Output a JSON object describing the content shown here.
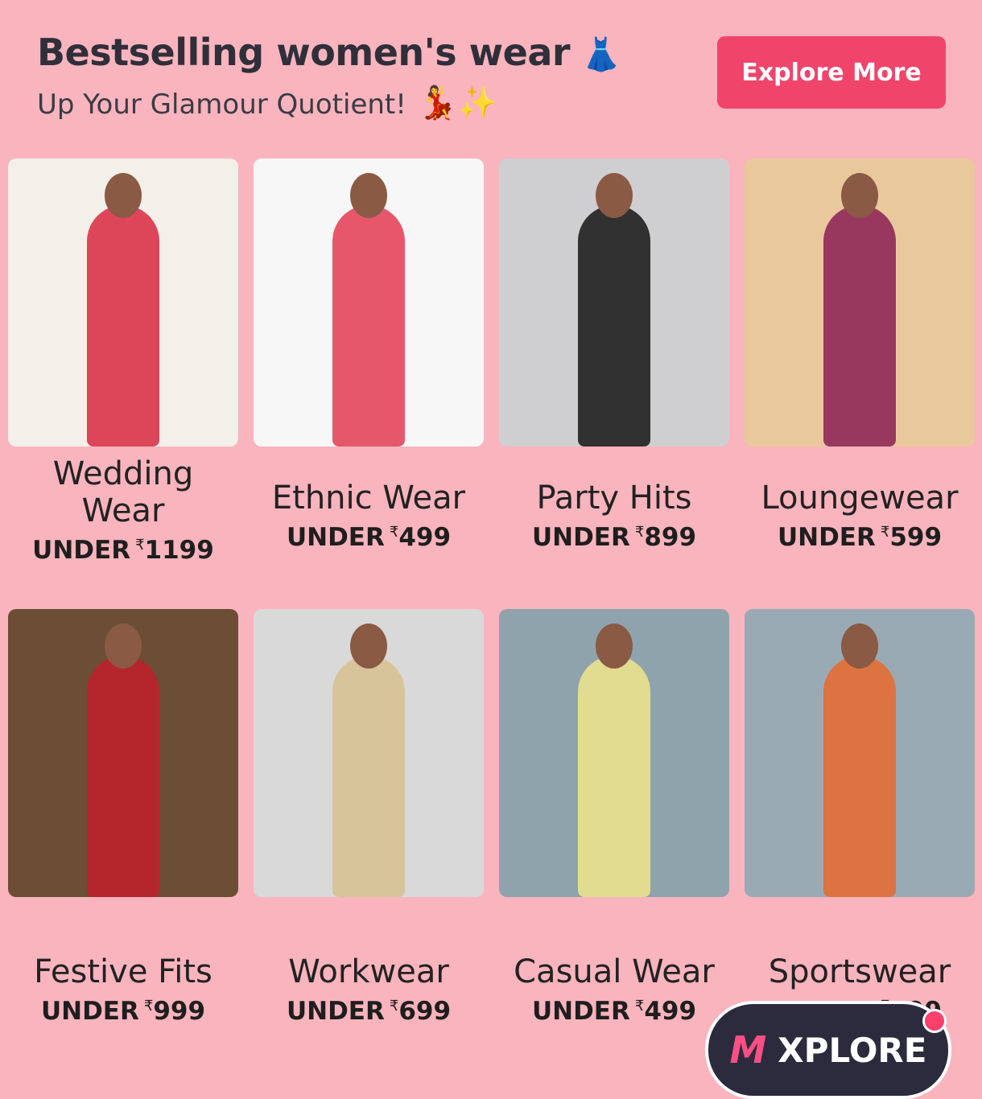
{
  "header": {
    "title": "Bestselling women's wear",
    "title_emoji": "👗",
    "subtitle": "Up Your Glamour Quotient!",
    "subtitle_emoji": "💃✨",
    "explore_label": "Explore More"
  },
  "cards": [
    {
      "name": "Wedding Wear",
      "price_prefix": "UNDER",
      "currency": "₹",
      "price": "1199",
      "bg": "#f3efe9",
      "accent": "#d8283f"
    },
    {
      "name": "Ethnic Wear",
      "price_prefix": "UNDER",
      "currency": "₹",
      "price": "499",
      "bg": "#f7f7f7",
      "accent": "#e33b52"
    },
    {
      "name": "Party Hits",
      "price_prefix": "UNDER",
      "currency": "₹",
      "price": "899",
      "bg": "#cfcfd2",
      "accent": "#151515"
    },
    {
      "name": "Loungewear",
      "price_prefix": "UNDER",
      "currency": "₹",
      "price": "599",
      "bg": "#e9c99c",
      "accent": "#8b1f55"
    },
    {
      "name": "Festive Fits",
      "price_prefix": "UNDER",
      "currency": "₹",
      "price": "999",
      "bg": "#6b4e35",
      "accent": "#c21f2a"
    },
    {
      "name": "Workwear",
      "price_prefix": "UNDER",
      "currency": "₹",
      "price": "699",
      "bg": "#d9d9d9",
      "accent": "#d6c08e"
    },
    {
      "name": "Casual Wear",
      "price_prefix": "UNDER",
      "currency": "₹",
      "price": "499",
      "bg": "#8fa3ad",
      "accent": "#f0e68a"
    },
    {
      "name": "Sportswear",
      "price_prefix": "UNDER",
      "currency": "₹",
      "price": "599",
      "bg": "#9aaab5",
      "accent": "#e86a2c"
    }
  ],
  "xplore": {
    "logo": "M",
    "label": "XPLORE"
  },
  "colors": {
    "background": "#fab4bd",
    "button": "#f0446b"
  }
}
